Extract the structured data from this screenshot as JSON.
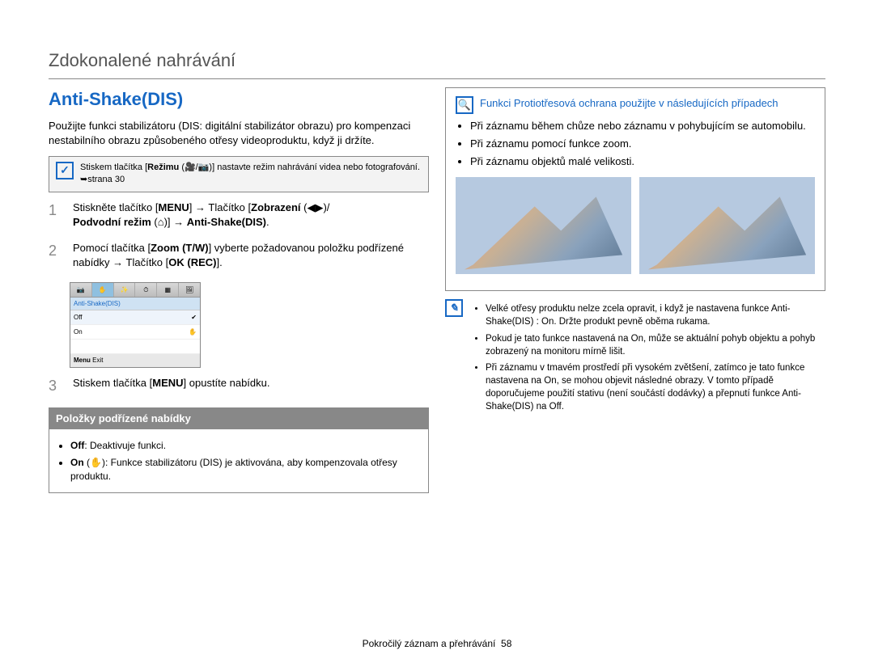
{
  "title": "Zdokonalené nahrávání",
  "section": "Anti-Shake(DIS)",
  "intro": "Použijte funkci stabilizátoru (DIS: digitální stabilizátor obrazu) pro kompenzaci nestabilního obrazu způsobeného otřesy videoproduktu, když ji držíte.",
  "callout": {
    "text1": "Stiskem tlačítka [",
    "bold1": "Režimu",
    "text2": " (🎥/📷)] nastavte režim nahrávání videa nebo fotografování. ➥strana 30"
  },
  "steps": {
    "s1": {
      "num": "1",
      "a": "Stiskněte tlačítko [",
      "b1": "MENU",
      "c": "] → Tlačítko [",
      "b2": "Zobrazení",
      "d": " (◀▶)/",
      "b3": "Podvodní režim",
      "e": " (⌂)] → ",
      "b4": "Anti-Shake(DIS)",
      "f": "."
    },
    "s2": {
      "num": "2",
      "a": "Pomocí tlačítka [",
      "b1": "Zoom (T/W)",
      "c": "] vyberte požadovanou položku podřízené nabídky → Tlačítko [",
      "b2": "OK (REC)",
      "d": "]."
    },
    "s3": {
      "num": "3",
      "a": "Stiskem tlačítka [",
      "b1": "MENU",
      "c": "] opustíte nabídku."
    }
  },
  "menu_sim": {
    "head": "Anti-Shake(DIS)",
    "off": "Off",
    "on": "On",
    "exit_label": "Menu",
    "exit": "Exit"
  },
  "sub": {
    "title": "Položky podřízené nabídky",
    "off_label": "Off",
    "off_desc": ": Deaktivuje funkci.",
    "on_label": "On",
    "on_desc": " (✋): Funkce stabilizátoru (DIS) je aktivována, aby kompenzovala otřesy produktu."
  },
  "right_title": "Funkci Protiotřesová ochrana použijte v následujících případech",
  "right_bullets": [
    "Při záznamu během chůze nebo záznamu v pohybujícím se automobilu.",
    "Při záznamu pomocí funkce zoom.",
    "Při záznamu objektů malé velikosti."
  ],
  "notes": [
    "Velké otřesy produktu nelze zcela opravit, i když je nastavena funkce Anti-Shake(DIS) : On. Držte produkt pevně oběma rukama.",
    "Pokud je tato funkce nastavená na On, může se aktuální pohyb objektu a pohyb zobrazený na monitoru mírně lišit.",
    "Při záznamu v tmavém prostředí při vysokém zvětšení, zatímco je tato funkce nastavena na On, se mohou objevit následné obrazy. V tomto případě doporučujeme použití stativu (není součástí dodávky) a přepnutí funkce Anti-Shake(DIS) na Off."
  ],
  "footer": {
    "label": "Pokročilý záznam a přehrávání",
    "page": "58"
  }
}
